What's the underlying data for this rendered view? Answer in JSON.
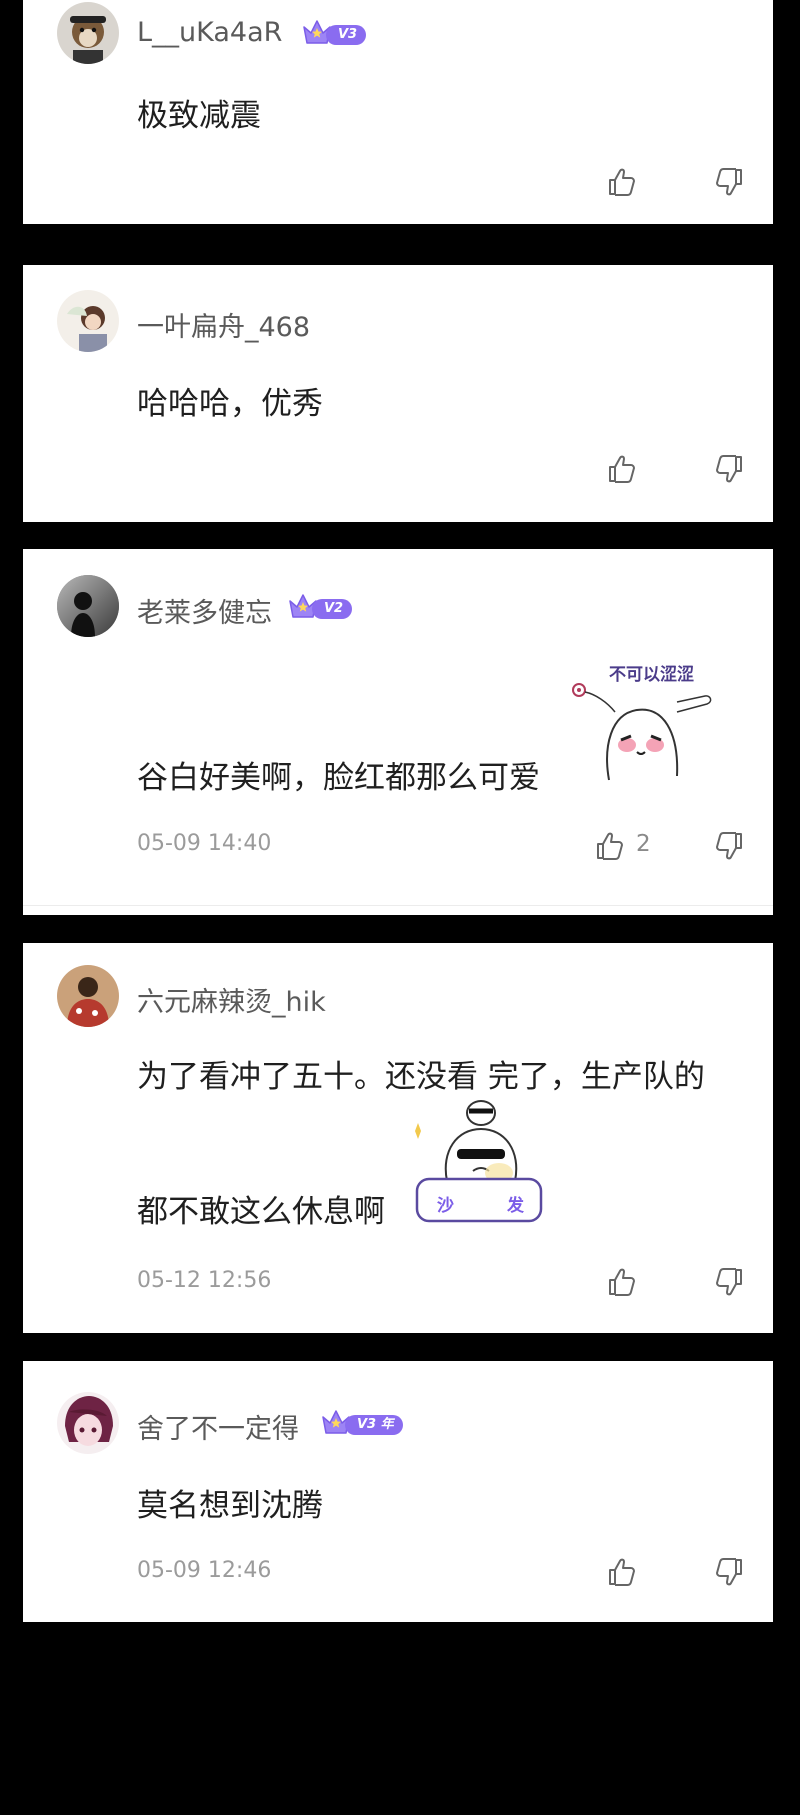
{
  "comments": [
    {
      "username": "L__uKa4aR",
      "badge": "V3",
      "text": "极致减震",
      "timestamp": "",
      "likes": ""
    },
    {
      "username": "一叶扁舟_468",
      "badge": "",
      "text": "哈哈哈，优秀",
      "timestamp": "",
      "likes": ""
    },
    {
      "username": "老莱多健忘",
      "badge": "V2",
      "text": "谷白好美啊，脸红都那么可爱",
      "timestamp": "05-09 14:40",
      "likes": "2",
      "sticker_text": "不可以涩涩"
    },
    {
      "username": "六元麻辣烫_hik",
      "badge": "",
      "text_line1": "为了看冲了五十。还没看 完了，生产队的",
      "text_line2": "都不敢这么休息啊",
      "timestamp": "05-12 12:56",
      "likes": "",
      "sticker_text_left": "沙",
      "sticker_text_right": "发"
    },
    {
      "username": "舍了不一定得",
      "badge": "V3 年",
      "text": "莫名想到沈腾",
      "timestamp": "05-09 12:46",
      "likes": ""
    }
  ],
  "colors": {
    "background": "#000000",
    "card": "#ffffff",
    "badge": "#8a6cf0",
    "text": "#1f1f1f",
    "meta": "#9b9b9b"
  }
}
